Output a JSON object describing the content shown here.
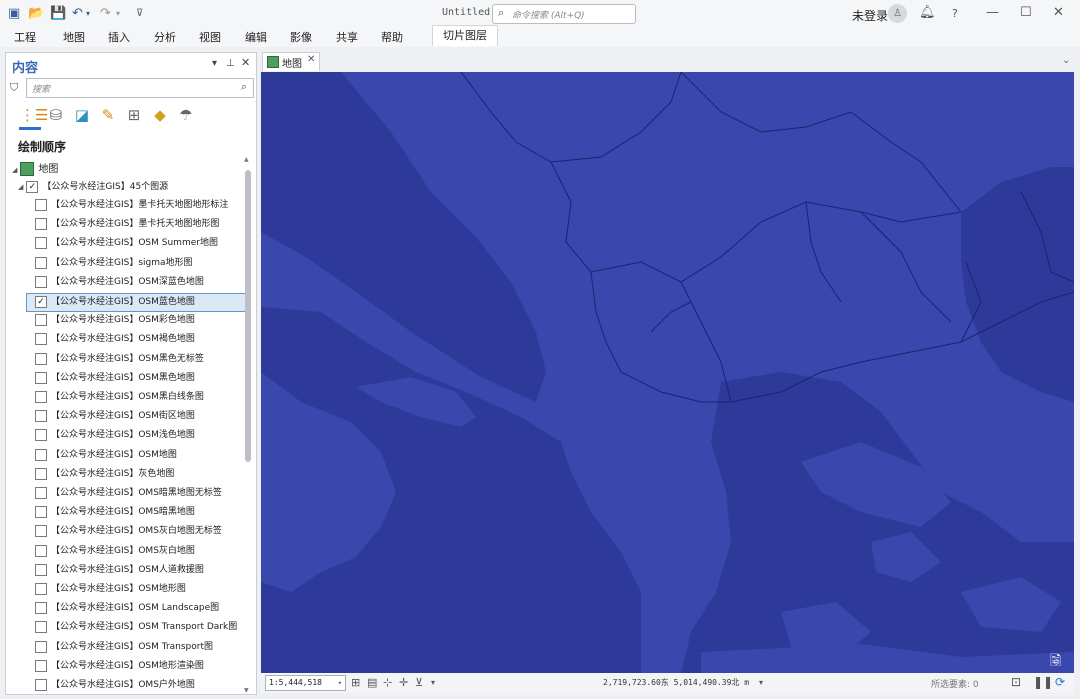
{
  "titlebar": {
    "doc_title": "Untitled",
    "search_placeholder": "命令搜索 (Alt+Q)",
    "user_label": "未登录"
  },
  "menus": [
    "工程",
    "地图",
    "插入",
    "分析",
    "视图",
    "编辑",
    "影像",
    "共享",
    "帮助"
  ],
  "context_tab": "切片图层",
  "contents_pane": {
    "title": "内容",
    "search_placeholder": "搜索",
    "section": "绘制顺序",
    "map_node": "地图",
    "group": "【公众号水经注GIS】45个图源",
    "layers": [
      {
        "label": "【公众号水经注GIS】墨卡托天地图地形标注",
        "checked": false
      },
      {
        "label": "【公众号水经注GIS】墨卡托天地图地形图",
        "checked": false
      },
      {
        "label": "【公众号水经注GIS】OSM Summer地图",
        "checked": false
      },
      {
        "label": "【公众号水经注GIS】sigma地形图",
        "checked": false
      },
      {
        "label": "【公众号水经注GIS】OSM深蓝色地图",
        "checked": false
      },
      {
        "label": "【公众号水经注GIS】OSM蓝色地图",
        "checked": true
      },
      {
        "label": "【公众号水经注GIS】OSM彩色地图",
        "checked": false
      },
      {
        "label": "【公众号水经注GIS】OSM褐色地图",
        "checked": false
      },
      {
        "label": "【公众号水经注GIS】OSM黑色无标签",
        "checked": false
      },
      {
        "label": "【公众号水经注GIS】OSM黑色地图",
        "checked": false
      },
      {
        "label": "【公众号水经注GIS】OSM黑白线条图",
        "checked": false
      },
      {
        "label": "【公众号水经注GIS】OSM街区地图",
        "checked": false
      },
      {
        "label": "【公众号水经注GIS】OSM浅色地图",
        "checked": false
      },
      {
        "label": "【公众号水经注GIS】OSM地图",
        "checked": false
      },
      {
        "label": "【公众号水经注GIS】灰色地图",
        "checked": false
      },
      {
        "label": "【公众号水经注GIS】OMS暗黑地图无标签",
        "checked": false
      },
      {
        "label": "【公众号水经注GIS】OMS暗黑地图",
        "checked": false
      },
      {
        "label": "【公众号水经注GIS】OMS灰白地图无标签",
        "checked": false
      },
      {
        "label": "【公众号水经注GIS】OMS灰白地图",
        "checked": false
      },
      {
        "label": "【公众号水经注GIS】OSM人道救援图",
        "checked": false
      },
      {
        "label": "【公众号水经注GIS】OSM地形图",
        "checked": false
      },
      {
        "label": "【公众号水经注GIS】OSM Landscape图",
        "checked": false
      },
      {
        "label": "【公众号水经注GIS】OSM Transport Dark图",
        "checked": false
      },
      {
        "label": "【公众号水经注GIS】OSM Transport图",
        "checked": false
      },
      {
        "label": "【公众号水经注GIS】OSM地形渲染图",
        "checked": false
      },
      {
        "label": "【公众号水经注GIS】OMS户外地图",
        "checked": false
      }
    ]
  },
  "map_tab": "地图",
  "statusbar": {
    "scale": "1:5,444,518",
    "coordinates": "2,719,723.60东 5,014,490.39北 m",
    "selected_features": "所选要素: 0"
  },
  "colors": {
    "map_land": "#3a48ad",
    "map_sea": "#2e3a99",
    "accent": "#2f6fd0"
  }
}
